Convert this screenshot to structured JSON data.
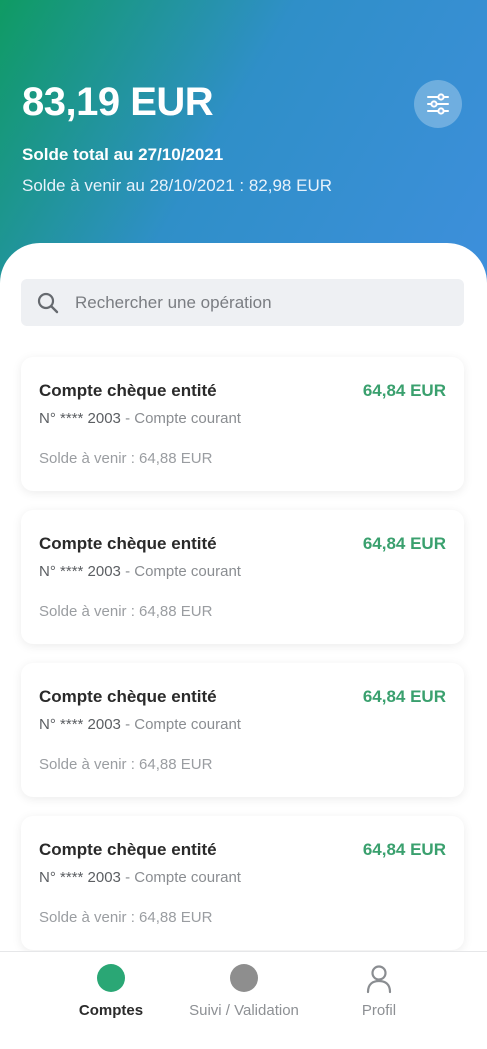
{
  "header": {
    "balance": "83,19 EUR",
    "total_label": "Solde total au 27/10/2021",
    "upcoming_label": "Solde à venir au 28/10/2021 : 82,98 EUR",
    "filter_icon": "sliders-icon"
  },
  "search": {
    "placeholder": "Rechercher une opération",
    "icon": "search-icon"
  },
  "accounts": [
    {
      "title": "Compte chèque entité",
      "amount": "64,84 EUR",
      "number_prefix": "N°",
      "number": "**** 2003",
      "type": " - Compte courant",
      "upcoming": "Solde à venir : 64,88 EUR"
    },
    {
      "title": "Compte chèque entité",
      "amount": "64,84 EUR",
      "number_prefix": "N°",
      "number": "**** 2003",
      "type": " - Compte courant",
      "upcoming": "Solde à venir : 64,88 EUR"
    },
    {
      "title": "Compte chèque entité",
      "amount": "64,84 EUR",
      "number_prefix": "N°",
      "number": "**** 2003",
      "type": " - Compte courant",
      "upcoming": "Solde à venir : 64,88 EUR"
    },
    {
      "title": "Compte chèque entité",
      "amount": "64,84 EUR",
      "number_prefix": "N°",
      "number": "**** 2003",
      "type": " - Compte courant",
      "upcoming": "Solde à venir : 64,88 EUR"
    }
  ],
  "nav": {
    "items": [
      {
        "label": "Comptes",
        "icon": "accounts-dot-icon",
        "active": true,
        "color": "#2aa775"
      },
      {
        "label": "Suivi / Validation",
        "icon": "tracking-dot-icon",
        "active": false,
        "color": "#8e8e8e"
      },
      {
        "label": "Profil",
        "icon": "profile-icon",
        "active": false
      }
    ]
  },
  "colors": {
    "amount": "#3aa06e",
    "gradient_start": "#0f9b63",
    "gradient_end": "#3e8fdc"
  }
}
